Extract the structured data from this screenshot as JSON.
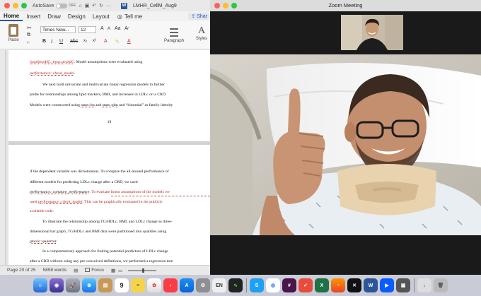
{
  "word": {
    "autosave_label": "AutoSave",
    "autosave_state": "OFF",
    "doc_title": "LMHR_CellM_Aug9",
    "tabs": [
      "Home",
      "Insert",
      "Draw",
      "Design",
      "Layout"
    ],
    "tell_me": "Tell me",
    "share": "Shar",
    "ribbon": {
      "paste": "Paste",
      "font_name": "Times New...",
      "font_size": "12",
      "paragraph": "Paragraph",
      "styles": "Styles"
    },
    "page1": {
      "l1a": "bootStepAIC::boot.stepAIC",
      "l1b": ". Model assumptions were evaluated using",
      "l2": "performance::check_model",
      "l2b": ".",
      "l3": "We next built univariate and multivariate linear regression models to further",
      "l4": "probe for relationships among lipid markers, BMI, and increases in LDLc on a CRD.",
      "l5a": "Models were constructed using ",
      "l5b": "stats::lm",
      "l5c": " and ",
      "l5d": "stats::glm",
      "l5e": " and “binomial” as family identity",
      "page_number": "19"
    },
    "page2": {
      "l1": "if the dependent variable was dichotomous. To compare the all-around performance of",
      "l2": "different models for predicting LDLc change after a CRD, we used",
      "l3a": "performance::compare_performance",
      "l3b": ". To evaluate linear assumptions of the models we",
      "l4a": "used ",
      "l4b": "performance::check_model",
      "l4c": ". This can be graphically evaluated in the publicly",
      "l5": "available code.",
      "l6": "To illustrate the relationship among TG/HDLc, BMI, and LDLc change as three-",
      "l7": "dimensional bar graph, TG/HDLc and BMI data were partitioned into quartiles using",
      "l8": "gtools::quantcut",
      "l8b": ".",
      "l9": "In a complementary approach for finding potential predictors of LDLc change",
      "l10": "after a CRD without using any pre-conceived definitions, we performed a regression tree"
    },
    "status": {
      "page": "Page 20 of 25",
      "words": "5858 words",
      "focus": "Focus"
    }
  },
  "zoom": {
    "title": "Zoom Meeting"
  },
  "dock": {
    "en_label": "EN",
    "calendar_day": "9"
  },
  "colors": {
    "word_blue": "#2b579a",
    "zoom_title_bg": "#dcdcdc",
    "dock_bg": "#c9ccd6",
    "spellcheck_red": "#b21f1f"
  }
}
